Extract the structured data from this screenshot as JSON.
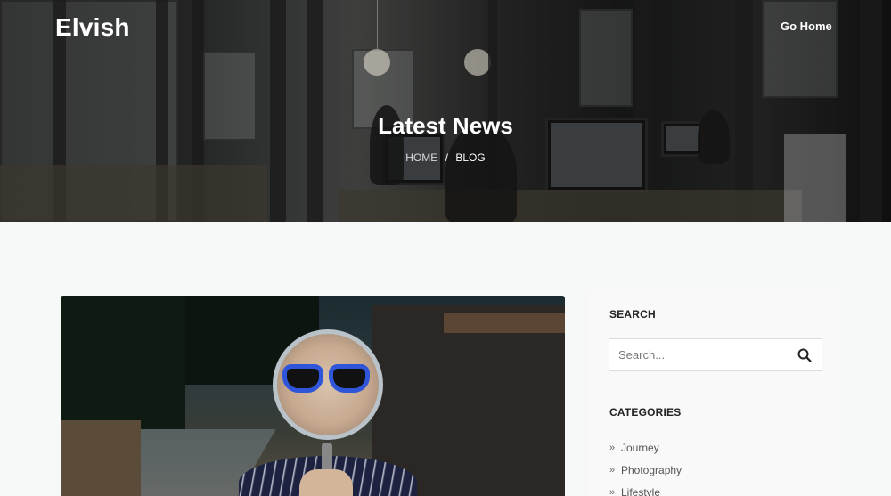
{
  "site": {
    "logo": "Elvish"
  },
  "nav": {
    "go_home": "Go Home"
  },
  "hero": {
    "title": "Latest News",
    "breadcrumb": {
      "home": "HOME",
      "separator": "/",
      "current": "BLOG"
    }
  },
  "post": {
    "image_icon": "magnifying-glass-person-photo"
  },
  "sidebar": {
    "search": {
      "title": "SEARCH",
      "placeholder": "Search...",
      "icon": "search-icon"
    },
    "categories": {
      "title": "CATEGORIES",
      "items": [
        {
          "label": "Journey"
        },
        {
          "label": "Photography"
        },
        {
          "label": "Lifestyle"
        }
      ]
    }
  },
  "colors": {
    "accent_lens": "#2f56d8",
    "page_bg": "#f7f8f8",
    "sidebar_bg": "#f9f9f9"
  }
}
